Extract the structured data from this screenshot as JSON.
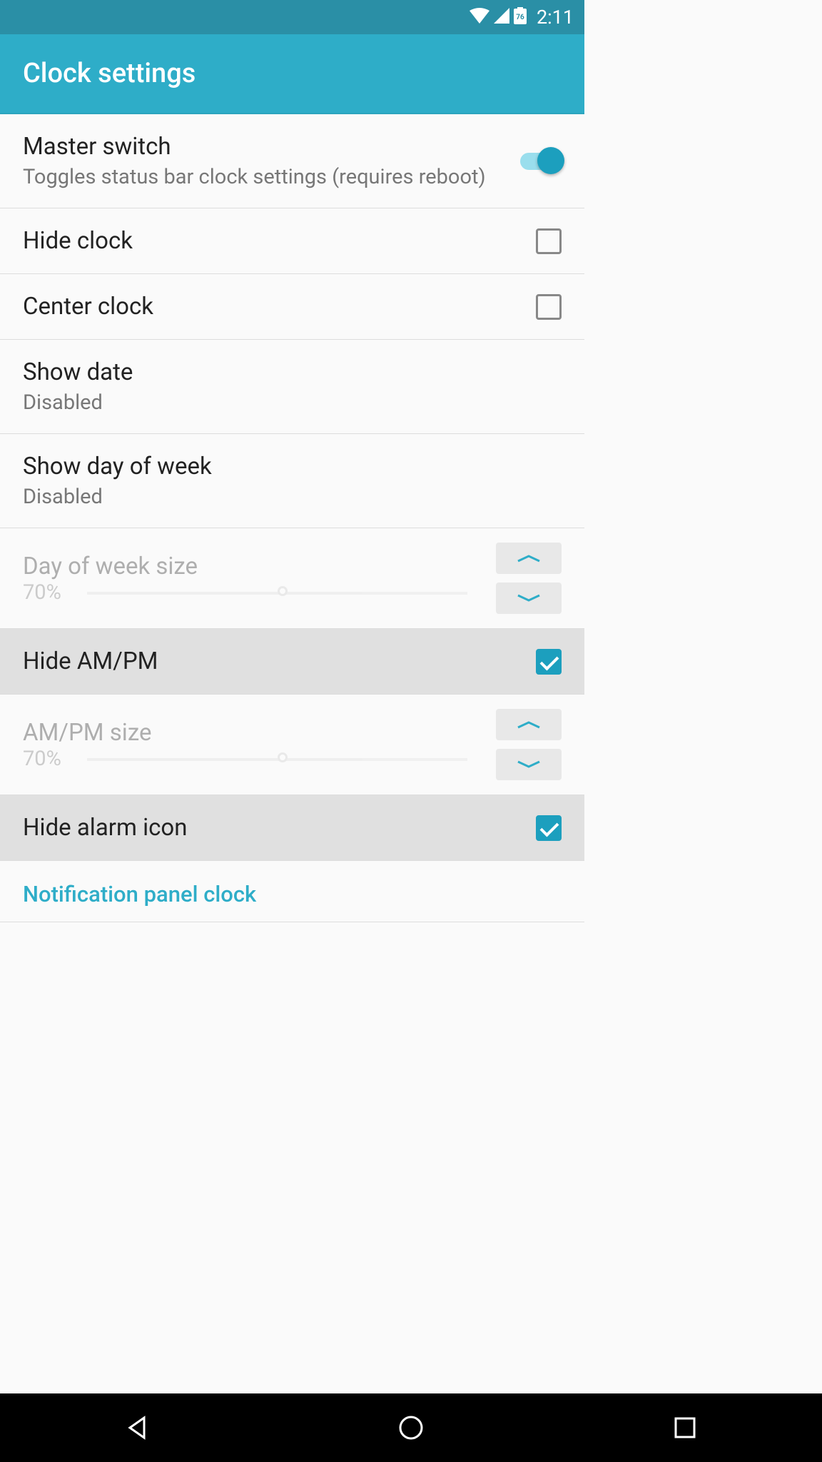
{
  "status_bar": {
    "battery_level": "76",
    "time": "2:11"
  },
  "app_bar": {
    "title": "Clock settings"
  },
  "settings": {
    "master_switch": {
      "title": "Master switch",
      "subtitle": "Toggles status bar clock settings (requires reboot)",
      "enabled": true
    },
    "hide_clock": {
      "title": "Hide clock",
      "checked": false
    },
    "center_clock": {
      "title": "Center clock",
      "checked": false
    },
    "show_date": {
      "title": "Show date",
      "value": "Disabled"
    },
    "show_day_of_week": {
      "title": "Show day of week",
      "value": "Disabled"
    },
    "day_of_week_size": {
      "title": "Day of week size",
      "value": "70%",
      "disabled": true
    },
    "hide_ampm": {
      "title": "Hide AM/PM",
      "checked": true
    },
    "ampm_size": {
      "title": "AM/PM size",
      "value": "70%",
      "disabled": true
    },
    "hide_alarm_icon": {
      "title": "Hide alarm icon",
      "checked": true
    }
  },
  "section": {
    "notification_panel": "Notification panel clock"
  }
}
